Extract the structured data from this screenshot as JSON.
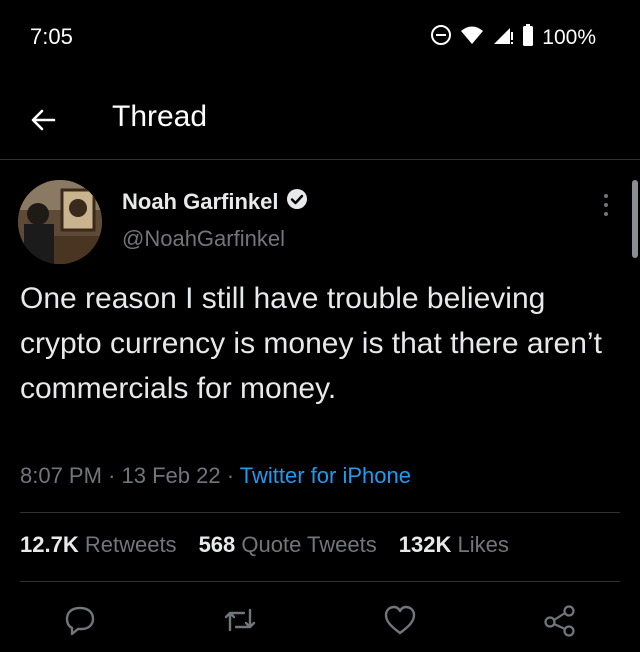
{
  "status_bar": {
    "time": "7:05",
    "battery": "100%",
    "icons": [
      "do-not-disturb-icon",
      "wifi-icon",
      "signal-icon",
      "battery-icon"
    ]
  },
  "header": {
    "back_icon": "back-arrow-icon",
    "title": "Thread"
  },
  "tweet": {
    "author_name": "Noah Garfinkel",
    "verified_icon": "verified-badge-icon",
    "handle": "@NoahGarfinkel",
    "more_icon": "more-options-icon",
    "text": "One reason I still have trouble believing crypto currency is money is that there aren’t commercials for money.",
    "time": "8:07 PM",
    "separator": "·",
    "date": "13 Feb 22",
    "source": "Twitter for iPhone"
  },
  "stats": {
    "retweets_count": "12.7K",
    "retweets_label": "Retweets",
    "quotes_count": "568",
    "quotes_label": "Quote Tweets",
    "likes_count": "132K",
    "likes_label": "Likes"
  },
  "actions": [
    "reply-icon",
    "retweet-icon",
    "like-icon",
    "share-icon"
  ],
  "colors": {
    "background": "#000000",
    "text": "#e7e9ea",
    "secondary": "#71767b",
    "accent": "#1d9bf0",
    "divider": "#2f3336"
  }
}
